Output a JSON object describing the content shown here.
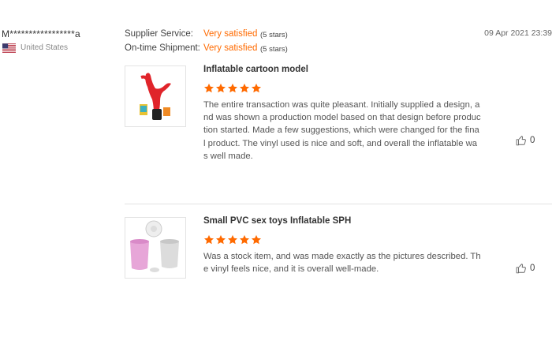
{
  "reviewer": {
    "name": "M*****************a",
    "country": "United States",
    "flag_icon": "us-flag-icon"
  },
  "ratings": [
    {
      "label": "Supplier Service:",
      "value": "Very satisfied",
      "stars": "(5 stars)"
    },
    {
      "label": "On-time Shipment:",
      "value": "Very satisfied",
      "stars": "(5 stars)"
    }
  ],
  "date": "09 Apr 2021 23:39",
  "reviews": [
    {
      "product_title": "Inflatable cartoon model",
      "star_count": 5,
      "text": "The entire transaction was quite pleasant. Initially supplied a design, and was shown a production model based on that design before production started. Made a few suggestions, which were changed for the final product. The vinyl used is nice and soft, and overall the inflatable was well made.",
      "likes": "0"
    },
    {
      "product_title": "Small PVC sex toys Inflatable SPH",
      "star_count": 5,
      "text": "Was a stock item, and was made exactly as the pictures described. The vinyl feels nice, and it is overall well-made.",
      "likes": "0"
    }
  ],
  "colors": {
    "accent": "#ff6a00",
    "star": "#ff6a00",
    "text": "#333333",
    "muted": "#888888",
    "divider": "#e3e3e3"
  }
}
